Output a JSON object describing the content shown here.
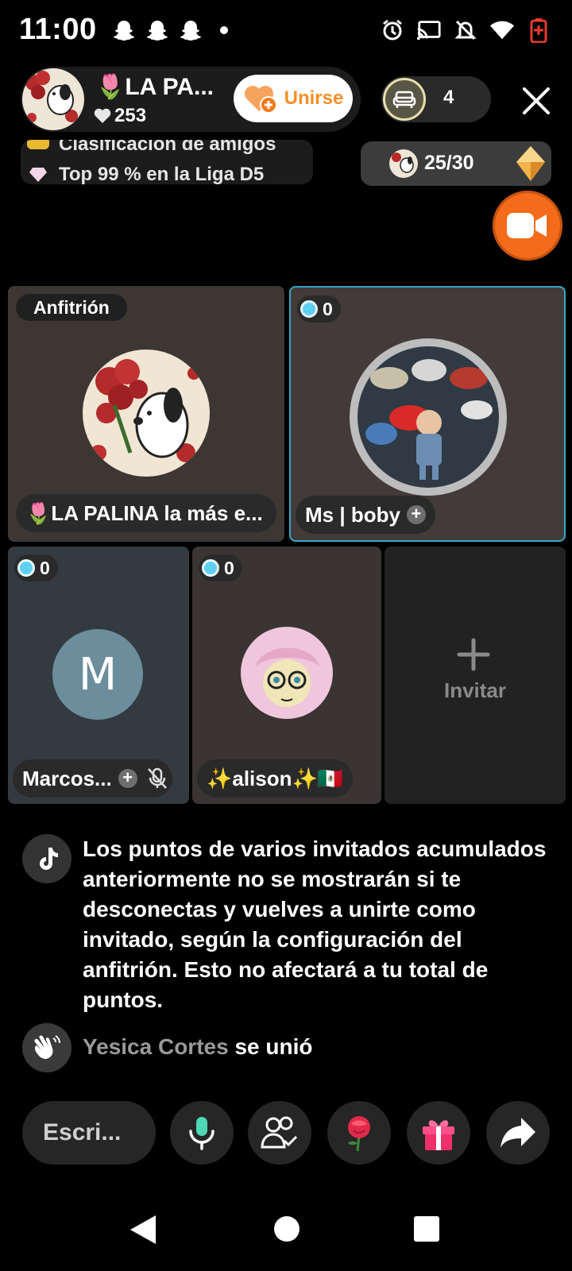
{
  "status_bar": {
    "time": "11:00",
    "icons_left": [
      "snapchat-icon",
      "snapchat-icon",
      "snapchat-icon",
      "dot-icon"
    ],
    "icons_right": [
      "alarm-icon",
      "cast-icon",
      "mute-icon",
      "wifi-icon",
      "battery-icon"
    ]
  },
  "header": {
    "host_name": "🌷LA PA...",
    "likes": "253",
    "join_label": "Unirse",
    "viewer_count": "4",
    "rank_line1": "Clasificación de amigos",
    "rank_line2": "Top 99 % en la Liga D5",
    "goal_progress": "25/30",
    "goal_fraction": 0.833
  },
  "grid": {
    "host_tag": "Anfitrión",
    "host_name": "🌷LA PALINA la más e...",
    "boby_points": "0",
    "boby_name": "Ms | boby",
    "marcos_points": "0",
    "marcos_initial": "M",
    "marcos_name": "Marcos...",
    "alison_points": "0",
    "alison_name": "✨alison✨🇲🇽",
    "invite_label": "Invitar"
  },
  "chat": {
    "system_message": "Los puntos de varios invitados acumulados anteriormente no se mostrarán si te desconectas y vuelves a unirte como invitado, según la configuración del anfitrión. Esto no afectará a tu total de puntos.",
    "join_user": "Yesica Cortes",
    "join_text": " se unió"
  },
  "bottom_bar": {
    "input_placeholder": "Escri...",
    "buttons": [
      "mic-icon",
      "guests-icon",
      "rose-gift-icon",
      "gift-icon",
      "share-icon"
    ]
  },
  "colors": {
    "accent_orange": "#f46b1b",
    "join_text": "#f79028",
    "selected_border": "#36a8c4",
    "gift_pink": "#f0306a"
  }
}
